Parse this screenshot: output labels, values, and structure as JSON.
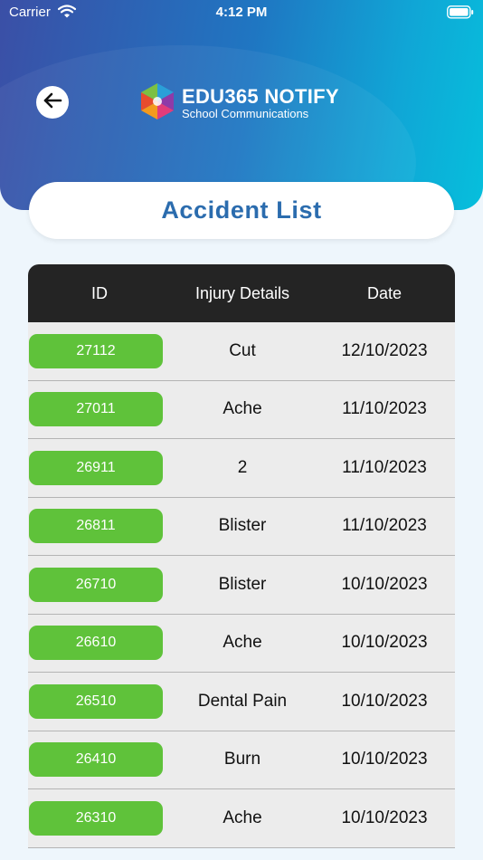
{
  "status_bar": {
    "carrier": "Carrier",
    "time": "4:12 PM"
  },
  "header": {
    "brand_name": "EDU365 NOTIFY",
    "brand_tagline": "School Communications"
  },
  "page": {
    "title": "Accident List"
  },
  "table": {
    "columns": [
      "ID",
      "Injury Details",
      "Date"
    ],
    "rows": [
      {
        "id": "27112",
        "detail": "Cut",
        "date": "12/10/2023"
      },
      {
        "id": "27011",
        "detail": "Ache",
        "date": "11/10/2023"
      },
      {
        "id": "26911",
        "detail": "2",
        "date": "11/10/2023"
      },
      {
        "id": "26811",
        "detail": "Blister",
        "date": "11/10/2023"
      },
      {
        "id": "26710",
        "detail": "Blister",
        "date": "10/10/2023"
      },
      {
        "id": "26610",
        "detail": "Ache",
        "date": "10/10/2023"
      },
      {
        "id": "26510",
        "detail": "Dental Pain",
        "date": "10/10/2023"
      },
      {
        "id": "26410",
        "detail": "Burn",
        "date": "10/10/2023"
      },
      {
        "id": "26310",
        "detail": "Ache",
        "date": "10/10/2023"
      }
    ]
  },
  "colors": {
    "title_text": "#2b6cae",
    "id_badge": "#5fc23a",
    "table_header": "#242424",
    "row_background": "#ececec"
  },
  "icons": {
    "back": "arrow-left-icon",
    "wifi": "wifi-icon",
    "battery": "battery-icon",
    "logo": "logo-mark-icon"
  }
}
